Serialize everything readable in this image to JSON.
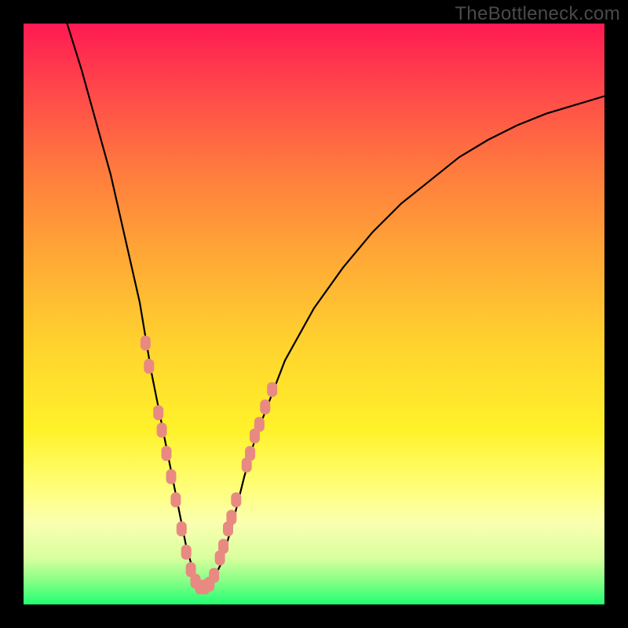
{
  "watermark": "TheBottleneck.com",
  "chart_data": {
    "type": "line",
    "title": "",
    "xlabel": "",
    "ylabel": "",
    "xlim": [
      0,
      100
    ],
    "ylim": [
      0,
      100
    ],
    "minimum_x": 30,
    "series": [
      {
        "name": "bottleneck-curve",
        "x": [
          5,
          10,
          15,
          20,
          22,
          24,
          26,
          28,
          30,
          32,
          34,
          36,
          38,
          40,
          45,
          50,
          55,
          60,
          65,
          70,
          75,
          80,
          85,
          90,
          95,
          100
        ],
        "values": [
          108,
          92,
          74,
          52,
          40,
          30,
          20,
          10,
          3,
          3,
          7,
          14,
          22,
          29,
          42,
          51,
          58,
          64,
          69,
          73,
          77,
          80,
          82.5,
          84.5,
          86,
          87.5
        ]
      }
    ],
    "markers": {
      "name": "highlighted-points",
      "color": "#e88a82",
      "points": [
        {
          "x": 21.0,
          "y": 45
        },
        {
          "x": 21.6,
          "y": 41
        },
        {
          "x": 23.2,
          "y": 33
        },
        {
          "x": 23.8,
          "y": 30
        },
        {
          "x": 24.6,
          "y": 26
        },
        {
          "x": 25.4,
          "y": 22
        },
        {
          "x": 26.2,
          "y": 18
        },
        {
          "x": 27.2,
          "y": 13
        },
        {
          "x": 28.0,
          "y": 9
        },
        {
          "x": 28.8,
          "y": 6
        },
        {
          "x": 29.6,
          "y": 4
        },
        {
          "x": 30.4,
          "y": 3
        },
        {
          "x": 31.2,
          "y": 3
        },
        {
          "x": 32.0,
          "y": 3.5
        },
        {
          "x": 32.8,
          "y": 5
        },
        {
          "x": 33.8,
          "y": 8
        },
        {
          "x": 34.4,
          "y": 10
        },
        {
          "x": 35.2,
          "y": 13
        },
        {
          "x": 35.8,
          "y": 15
        },
        {
          "x": 36.6,
          "y": 18
        },
        {
          "x": 38.4,
          "y": 24
        },
        {
          "x": 39.0,
          "y": 26
        },
        {
          "x": 39.8,
          "y": 29
        },
        {
          "x": 40.6,
          "y": 31
        },
        {
          "x": 41.6,
          "y": 34
        },
        {
          "x": 42.8,
          "y": 37
        }
      ]
    }
  }
}
